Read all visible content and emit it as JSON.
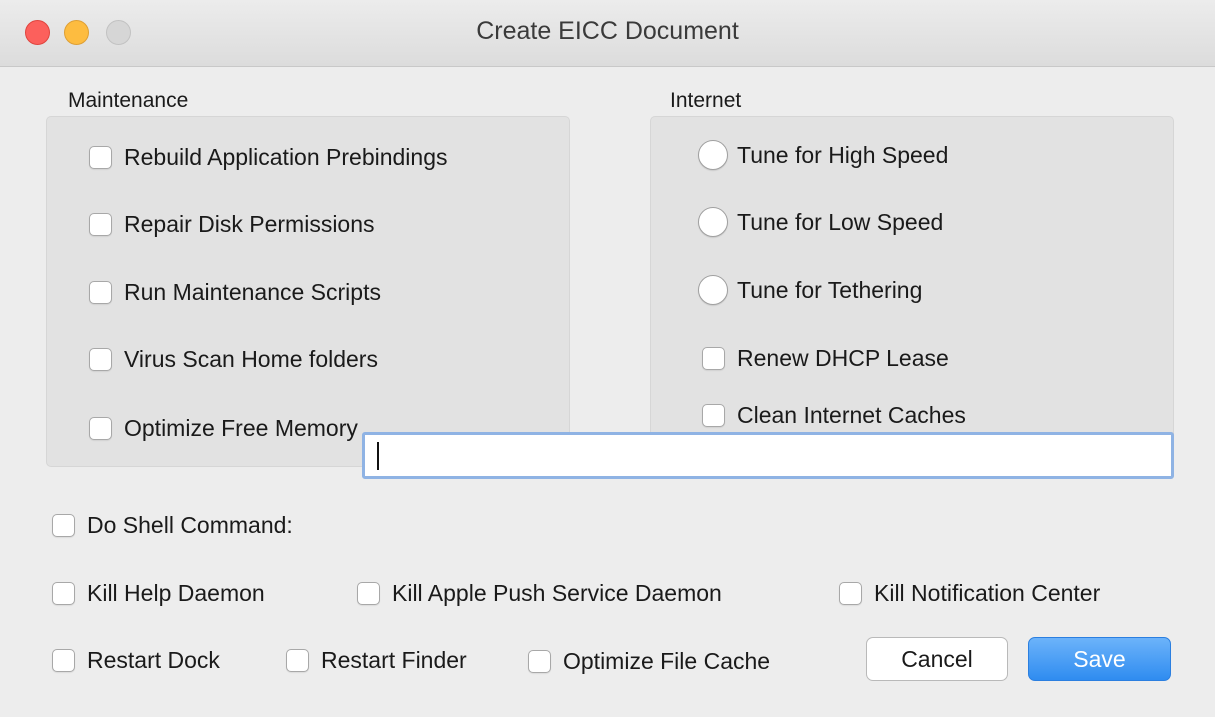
{
  "window": {
    "title": "Create EICC Document"
  },
  "maintenance": {
    "label": "Maintenance",
    "items": [
      "Rebuild Application Prebindings",
      "Repair Disk Permissions",
      "Run Maintenance Scripts",
      "Virus Scan Home folders",
      "Optimize Free Memory"
    ]
  },
  "internet": {
    "label": "Internet",
    "radios": [
      "Tune for High Speed",
      "Tune for Low Speed",
      "Tune for Tethering"
    ],
    "checkboxes": [
      "Renew DHCP Lease",
      "Clean Internet Caches"
    ]
  },
  "shell": {
    "label": "Do Shell Command:",
    "value": ""
  },
  "daemons": [
    "Kill Help Daemon",
    "Kill Apple Push Service Daemon",
    "Kill Notification Center"
  ],
  "restart": [
    "Restart Dock",
    "Restart Finder",
    "Optimize File Cache"
  ],
  "buttons": {
    "cancel": "Cancel",
    "save": "Save"
  }
}
